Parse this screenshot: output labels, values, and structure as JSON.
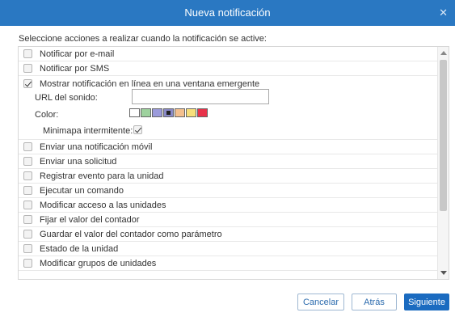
{
  "dialog": {
    "title": "Nueva notificación",
    "close_icon": "close-icon",
    "intro": "Seleccione acciones a realizar cuando la notificación se active:"
  },
  "actions": [
    {
      "label": "Notificar por e-mail",
      "checked": false
    },
    {
      "label": "Notificar por SMS",
      "checked": false
    },
    {
      "label": "Mostrar notificación en línea en una ventana emergente",
      "checked": true
    },
    {
      "label": "Enviar una notificación móvil",
      "checked": false
    },
    {
      "label": "Enviar una solicitud",
      "checked": false
    },
    {
      "label": "Registrar evento para la unidad",
      "checked": false
    },
    {
      "label": "Ejecutar un comando",
      "checked": false
    },
    {
      "label": "Modificar acceso a las unidades",
      "checked": false
    },
    {
      "label": "Fijar el valor del contador",
      "checked": false
    },
    {
      "label": "Guardar el valor del contador como parámetro",
      "checked": false
    },
    {
      "label": "Estado de la unidad",
      "checked": false
    },
    {
      "label": "Modificar grupos de unidades",
      "checked": false
    }
  ],
  "popup_options": {
    "sound_url_label": "URL del sonido:",
    "sound_url_value": "",
    "color_label": "Color:",
    "colors": [
      "#ffffff",
      "#9ed29e",
      "#9b9bdb",
      "#8a8ac8",
      "#f4c08e",
      "#f7df7a",
      "#e8324a"
    ],
    "selected_color_index": 3,
    "minimap_label": "Minimapa intermitente:",
    "minimap_checked": true
  },
  "buttons": {
    "cancel": "Cancelar",
    "back": "Atrás",
    "next": "Siguiente"
  },
  "colors": {
    "titlebar": "#2a78c2",
    "primary_button": "#1b6bc0"
  }
}
